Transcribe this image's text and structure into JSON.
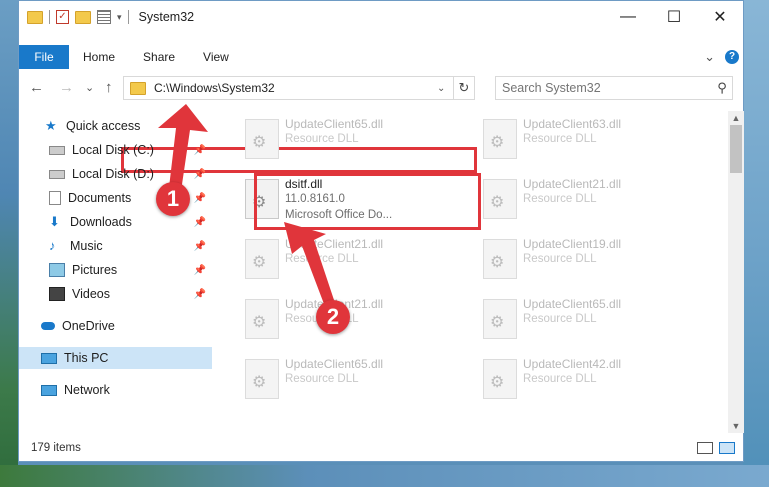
{
  "window": {
    "title": "System32",
    "minimize": "—",
    "maximize": "☐",
    "close": "✕"
  },
  "ribbon": {
    "file_tab": "File",
    "tabs": [
      "Home",
      "Share",
      "View"
    ],
    "expand": "⌄",
    "help": "?"
  },
  "nav": {
    "back": "←",
    "forward": "→",
    "recent": "⌄",
    "up": "↑",
    "address_path": "C:\\Windows\\System32",
    "address_dropdown": "⌄",
    "refresh": "↻",
    "search_placeholder": "Search System32",
    "search_icon": "⚲"
  },
  "sidebar": {
    "items": [
      {
        "label": "Quick access",
        "icon": "star-icon"
      },
      {
        "label": "Local Disk (C:)",
        "icon": "disk-icon",
        "pinned": true
      },
      {
        "label": "Local Disk (D:)",
        "icon": "disk-icon",
        "pinned": true
      },
      {
        "label": "Documents",
        "icon": "documents-icon",
        "pinned": true
      },
      {
        "label": "Downloads",
        "icon": "downloads-icon",
        "pinned": true
      },
      {
        "label": "Music",
        "icon": "music-icon",
        "pinned": true
      },
      {
        "label": "Pictures",
        "icon": "pictures-icon",
        "pinned": true
      },
      {
        "label": "Videos",
        "icon": "videos-icon",
        "pinned": true
      },
      {
        "label": "OneDrive",
        "icon": "onedrive-icon"
      },
      {
        "label": "This PC",
        "icon": "pc-icon",
        "selected": true
      },
      {
        "label": "Network",
        "icon": "network-icon"
      }
    ],
    "pin_glyph": "📌"
  },
  "files": [
    {
      "name": "UpdateClient65.dll",
      "desc": "Resource DLL"
    },
    {
      "name": "UpdateClient63.dll",
      "desc": "Resource DLL"
    },
    {
      "name": "dsitf.dll",
      "version": "11.0.8161.0",
      "desc": "Microsoft Office Do...",
      "highlighted": true
    },
    {
      "name": "UpdateClient21.dll",
      "desc": "Resource DLL"
    },
    {
      "name": "UpdateClient21.dll",
      "desc": "Resource DLL"
    },
    {
      "name": "UpdateClient19.dll",
      "desc": "Resource DLL"
    },
    {
      "name": "UpdateClient21.dll",
      "desc": "Resource DLL"
    },
    {
      "name": "UpdateClient65.dll",
      "desc": "Resource DLL"
    },
    {
      "name": "UpdateClient65.dll",
      "desc": "Resource DLL"
    },
    {
      "name": "UpdateClient42.dll",
      "desc": "Resource DLL"
    }
  ],
  "status": {
    "item_count": "179 items"
  },
  "annotations": {
    "step1": "1",
    "step2": "2",
    "color": "#e0353b"
  },
  "colors": {
    "accent": "#1979ca",
    "selection": "#cce4f7",
    "callout": "#e0353b"
  }
}
